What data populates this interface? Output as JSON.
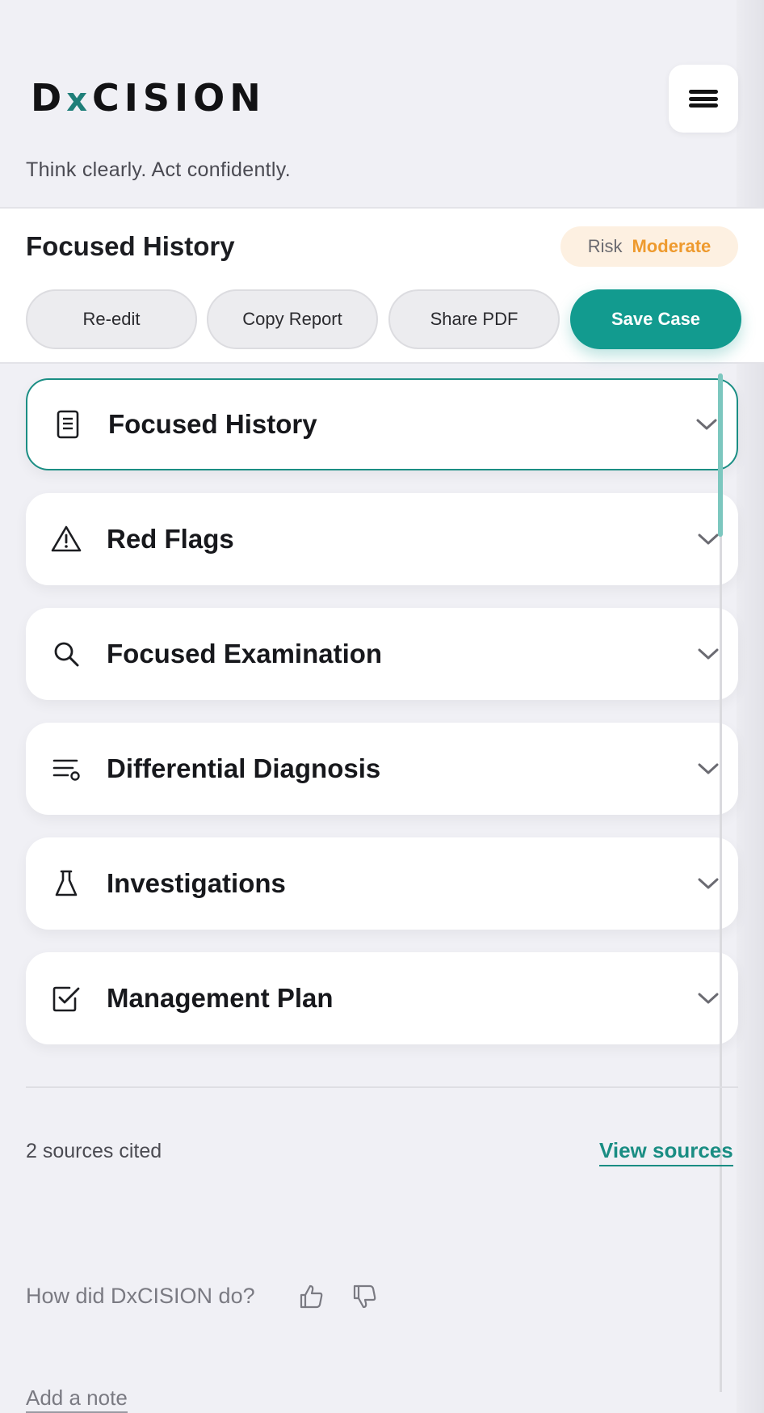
{
  "header": {
    "logo": {
      "part1": "D",
      "part2": "x",
      "part3": "CISION"
    },
    "tagline": "Think clearly. Act confidently.",
    "menu_icon": "hamburger-menu-icon"
  },
  "summary": {
    "title": "Focused History",
    "risk_label": "Risk",
    "risk_value": "Moderate",
    "actions": {
      "reedit": "Re-edit",
      "copy": "Copy Report",
      "share": "Share PDF",
      "save": "Save Case"
    }
  },
  "sections": [
    {
      "label": "Focused History",
      "icon": "document-icon",
      "active": true
    },
    {
      "label": "Red Flags",
      "icon": "warning-icon"
    },
    {
      "label": "Focused Examination",
      "icon": "search-icon"
    },
    {
      "label": "Differential Diagnosis",
      "icon": "list-icon"
    },
    {
      "label": "Investigations",
      "icon": "flask-icon"
    },
    {
      "label": "Management Plan",
      "icon": "checkbox-icon"
    }
  ],
  "sources": {
    "count_text": "2 sources cited",
    "link": "View sources"
  },
  "feedback": {
    "question": "How did DxCISION do?",
    "up_icon": "thumbs-up-icon",
    "down_icon": "thumbs-down-icon"
  },
  "note": {
    "link": "Add a note"
  },
  "colors": {
    "accent": "#129b8f",
    "risk": "#ee9a2e",
    "risk_bg": "#fdf0e1",
    "background": "#f0f0f5"
  }
}
